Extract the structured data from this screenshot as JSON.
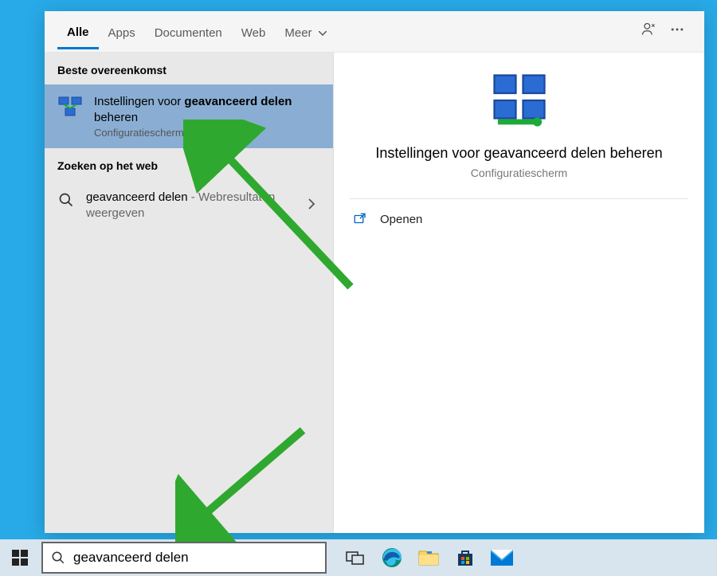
{
  "tabs": {
    "all": "Alle",
    "apps": "Apps",
    "documents": "Documenten",
    "web": "Web",
    "more": "Meer"
  },
  "left": {
    "best_match_header": "Beste overeenkomst",
    "result1_prefix": "Instellingen voor ",
    "result1_bold": "geavanceerd delen",
    "result1_suffix": " beheren",
    "result1_sub": "Configuratiescherm",
    "web_header": "Zoeken op het web",
    "web_result_term": "geavanceerd delen",
    "web_result_suffix": " - Webresultaten weergeven"
  },
  "preview": {
    "title": "Instellingen voor geavanceerd delen beheren",
    "sub": "Configuratiescherm",
    "open": "Openen"
  },
  "search": {
    "value": "geavanceerd delen"
  },
  "colors": {
    "accent": "#0078d4",
    "selection": "#8aaed3",
    "arrow": "#2fa82f"
  }
}
